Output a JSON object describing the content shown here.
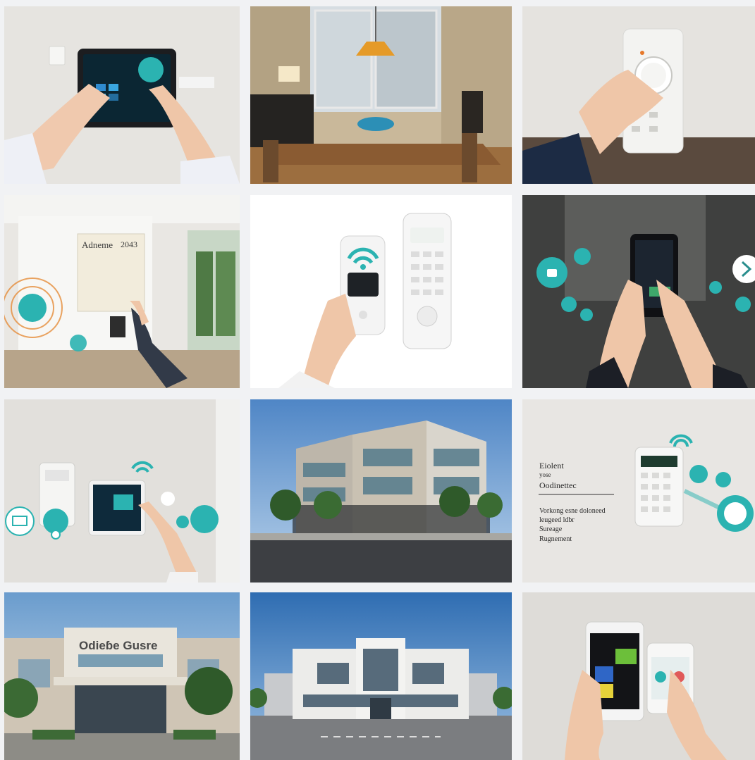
{
  "tiles": [
    {
      "name": "tile-tablet-wall-panel",
      "caption": ""
    },
    {
      "name": "tile-dining-room",
      "caption": ""
    },
    {
      "name": "tile-thermostat-dial",
      "caption": ""
    },
    {
      "name": "tile-lobby-access-screen",
      "caption": "",
      "screen_title": "Adneme",
      "screen_code": "2043"
    },
    {
      "name": "tile-remote-controls",
      "caption": ""
    },
    {
      "name": "tile-smartphone-icons",
      "caption": ""
    },
    {
      "name": "tile-wall-tablet-icons",
      "caption": ""
    },
    {
      "name": "tile-office-building",
      "caption": ""
    },
    {
      "name": "tile-keypad-text",
      "caption": "",
      "text_heading_1": "Eiolent",
      "text_heading_2": "yose",
      "text_heading_3": "Oodinettec",
      "text_body_1": "Vorkong esne doloneed",
      "text_body_2": "leugeed ldbr",
      "text_body_3": "Sureage",
      "text_body_4": "Rugnement"
    },
    {
      "name": "tile-building-facade-sign",
      "caption": "",
      "sign": "Odieɓe Gusre"
    },
    {
      "name": "tile-modern-building",
      "caption": ""
    },
    {
      "name": "tile-two-phones",
      "caption": ""
    }
  ],
  "colors": {
    "accent": "#2bb3b1",
    "background": "#f1f2f4"
  }
}
